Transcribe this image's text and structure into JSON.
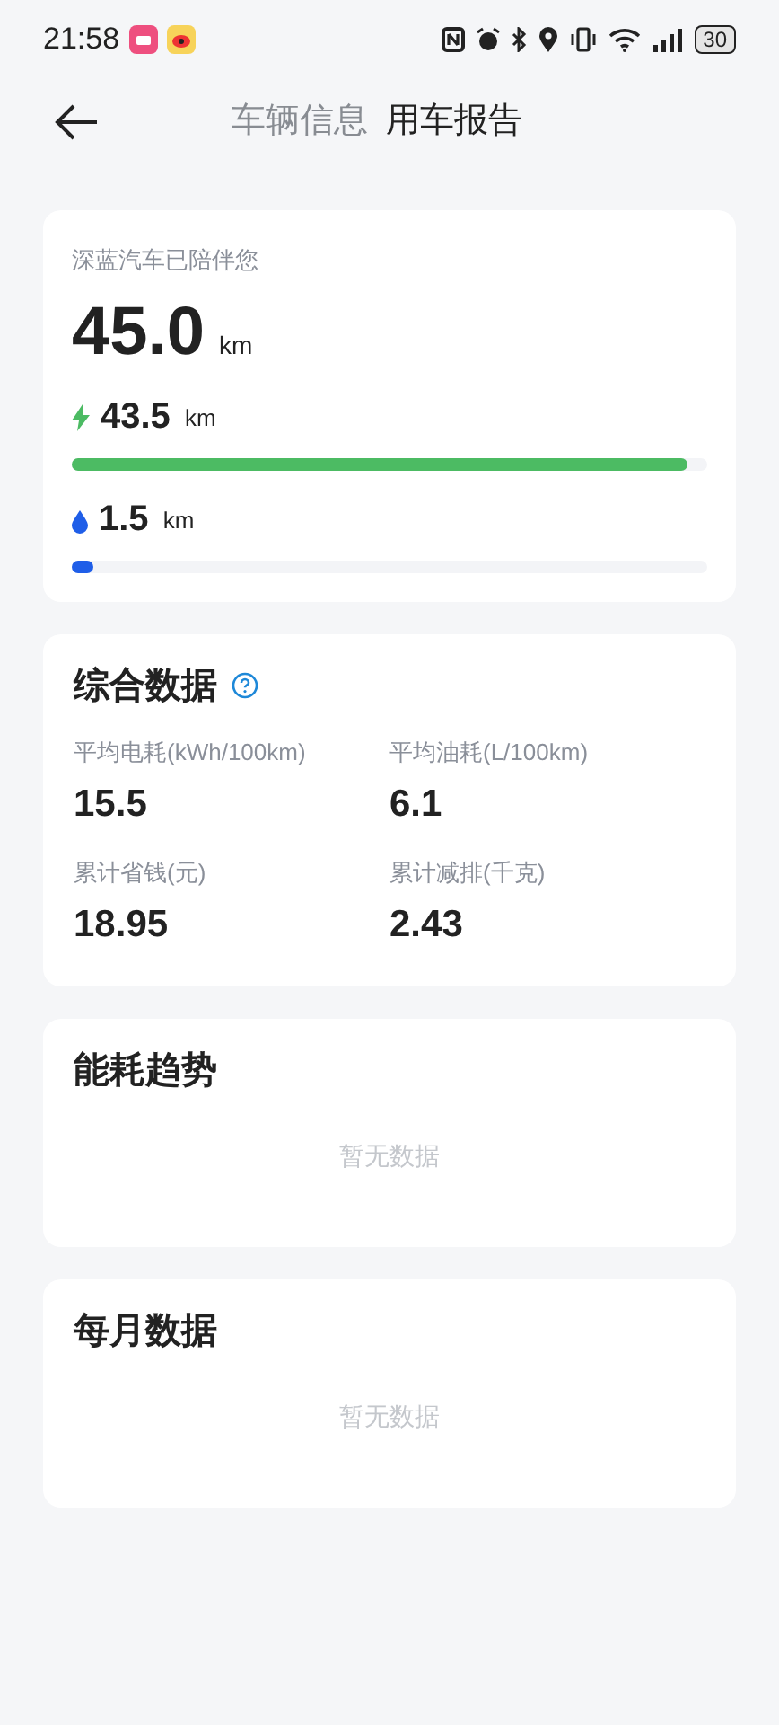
{
  "status_bar": {
    "time": "21:58",
    "battery": "30"
  },
  "tabs": [
    {
      "label": "车辆信息",
      "selected": false
    },
    {
      "label": "用车报告",
      "selected": true
    }
  ],
  "summary": {
    "caption": "深蓝汽车已陪伴您",
    "total": "45.0",
    "total_unit": "km",
    "sources": [
      {
        "kind": "electric",
        "value": "43.5",
        "unit": "km",
        "level": 0.97,
        "color": "#4cbb63"
      },
      {
        "kind": "fuel",
        "value": "1.5",
        "unit": "km",
        "level": 0.035,
        "color": "#1f5ee8"
      }
    ]
  },
  "overview": {
    "title": "综合数据",
    "metrics": [
      {
        "label": "平均电耗(kWh/100km)",
        "value": "15.5"
      },
      {
        "label": "平均油耗(L/100km)",
        "value": "6.1"
      },
      {
        "label": "累计省钱(元)",
        "value": "18.95"
      },
      {
        "label": "累计减排(千克)",
        "value": "2.43"
      }
    ]
  },
  "sections": [
    {
      "title": "能耗趋势",
      "empty_text": "暂无数据"
    },
    {
      "title": "每月数据",
      "empty_text": "暂无数据"
    }
  ]
}
